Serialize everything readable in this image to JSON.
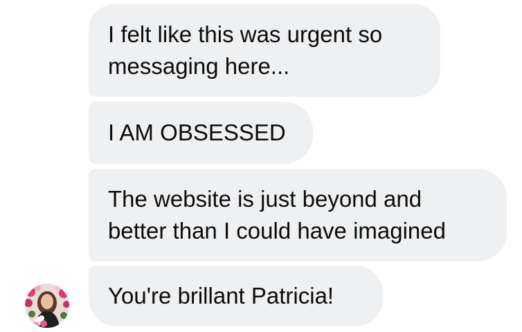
{
  "messages": [
    {
      "text": "I felt like this was urgent so\nmessaging here..."
    },
    {
      "text": "I AM OBSESSED"
    },
    {
      "text": "The website is just beyond and\nbetter than I could have imagined"
    },
    {
      "text": "You're brillant Patricia!"
    }
  ],
  "sender": {
    "avatar_icon": "profile-photo-woman-with-flowers"
  },
  "colors": {
    "bubble_background": "#eff0f2",
    "text": "#0b0b0b"
  }
}
